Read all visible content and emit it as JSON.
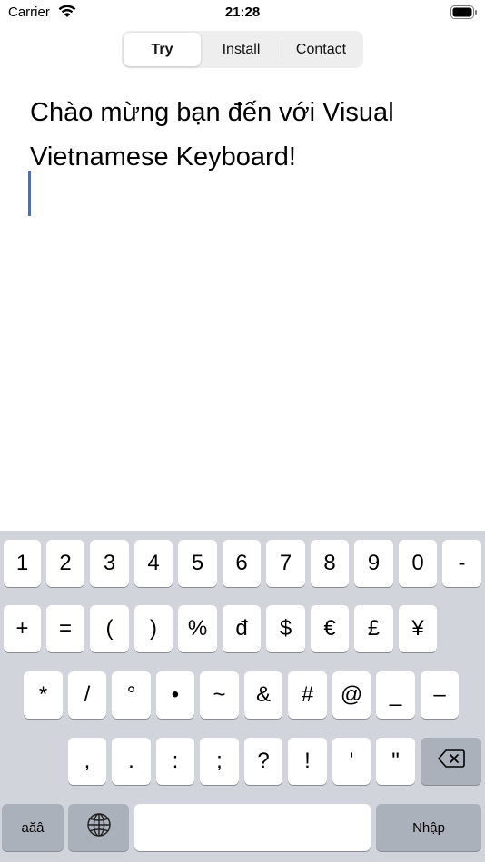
{
  "status_bar": {
    "carrier": "Carrier",
    "time": "21:28"
  },
  "tabs": [
    {
      "label": "Try",
      "selected": true
    },
    {
      "label": "Install",
      "selected": false
    },
    {
      "label": "Contact",
      "selected": false
    }
  ],
  "editor": {
    "lines": [
      "Chào mừng bạn đến với Visual",
      "Vietnamese Keyboard!"
    ]
  },
  "keyboard": {
    "row1": [
      "1",
      "2",
      "3",
      "4",
      "5",
      "6",
      "7",
      "8",
      "9",
      "0",
      "-"
    ],
    "row2": [
      "+",
      "=",
      "(",
      ")",
      "%",
      "đ",
      "$",
      "€",
      "£",
      "¥"
    ],
    "row3": [
      "*",
      "/",
      "°",
      "•",
      "~",
      "&",
      "#",
      "@",
      "_",
      "–"
    ],
    "row4": [
      ",",
      ".",
      ":",
      ";",
      "?",
      "!",
      "'",
      "\""
    ],
    "mode_key": "aăâ",
    "return_key": "Nhập",
    "icons": {
      "backspace": "backspace-icon",
      "globe": "globe-icon",
      "wifi": "wifi-icon",
      "battery": "battery-icon"
    }
  }
}
